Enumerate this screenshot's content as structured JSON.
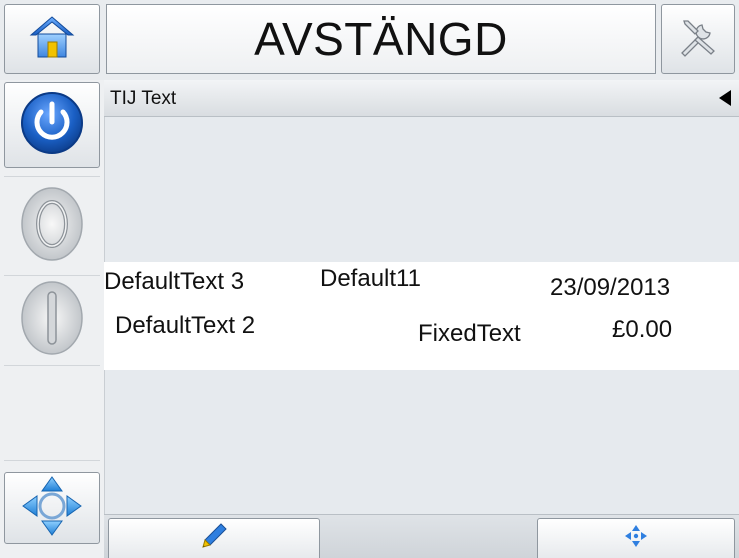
{
  "header": {
    "status_title": "AVSTÄNGD",
    "home_icon": "home-icon",
    "tools_icon": "tools-icon"
  },
  "sidebar": {
    "power_icon": "power-icon",
    "start_icon": "jet-start-icon",
    "stop_icon": "jet-stop-icon",
    "nav_icon": "navigation-arrows-icon"
  },
  "panel": {
    "header_label": "TIJ Text"
  },
  "label_preview": {
    "fields": [
      "DefaultText 3",
      "Default11",
      "23/09/2013",
      "DefaultText 2",
      "FixedText",
      "£0.00"
    ]
  },
  "bottom_toolbar": {
    "edit_icon": "pencil-icon",
    "move_icon": "move-arrows-icon"
  },
  "colors": {
    "power_blue": "#1a5fc4",
    "panel_background": "#e6eaee",
    "home_roof": "#2a6fd6",
    "home_door": "#f2c200"
  }
}
